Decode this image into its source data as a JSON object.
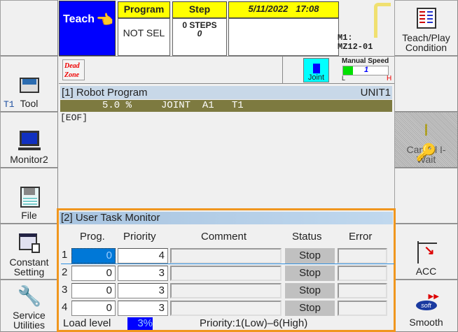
{
  "left_menu": [
    {
      "label": "",
      "icon": "blank"
    },
    {
      "label": "Tool",
      "sub": "T1",
      "icon": "toolbox-icon"
    },
    {
      "label": "Monitor2",
      "icon": "monitor-icon"
    },
    {
      "label": "File",
      "icon": "floppy-disk-icon"
    },
    {
      "label": "Constant Setting",
      "icon": "constant-setting-icon"
    },
    {
      "label": "Service Utilities",
      "icon": "wrench-icon"
    }
  ],
  "right_menu": [
    {
      "label": "Teach/Play Condition",
      "icon": "condition-icon"
    },
    {
      "label": "",
      "icon": "blank"
    },
    {
      "label": "Cancel I-Wait",
      "icon": "key-icon",
      "disabled": true
    },
    {
      "label": "",
      "icon": "blank"
    },
    {
      "label": "ACC",
      "icon": "acc-icon"
    },
    {
      "label": "Smooth",
      "icon": "soft-icon"
    }
  ],
  "header": {
    "mode": "Teach",
    "program_label": "Program",
    "program_value": "NOT SEL",
    "step_label": "Step",
    "step_value": "0 STEPS",
    "step_sub": "0",
    "datetime": "5/11/2022   17:08",
    "robot_line1": "M1:",
    "robot_line2": "MZ12-01",
    "mode_color": "#0000ff"
  },
  "status_bar": {
    "dead_zone": "Dead Zone",
    "joint": "Joint",
    "manual_speed_label": "Manual Speed",
    "manual_speed_value": "1",
    "speed_low": "L",
    "speed_high": "H"
  },
  "robot_program": {
    "title": "[1] Robot Program",
    "unit": "UNIT1",
    "status_line": "5.0 %     JOINT  A1   T1",
    "content": "[EOF]"
  },
  "task_monitor": {
    "title": "[2] User Task Monitor",
    "columns": [
      "Prog.",
      "Priority",
      "Comment",
      "Status",
      "Error"
    ],
    "rows": [
      {
        "n": "1",
        "prog": "0",
        "priority": "4",
        "comment": "",
        "status": "Stop",
        "error": ""
      },
      {
        "n": "2",
        "prog": "0",
        "priority": "3",
        "comment": "",
        "status": "Stop",
        "error": ""
      },
      {
        "n": "3",
        "prog": "0",
        "priority": "3",
        "comment": "",
        "status": "Stop",
        "error": ""
      },
      {
        "n": "4",
        "prog": "0",
        "priority": "3",
        "comment": "",
        "status": "Stop",
        "error": ""
      }
    ],
    "load_label": "Load level",
    "load_value": "3%",
    "priority_note": "Priority:1(Low)–6(High)",
    "accent": "#f0961e"
  }
}
